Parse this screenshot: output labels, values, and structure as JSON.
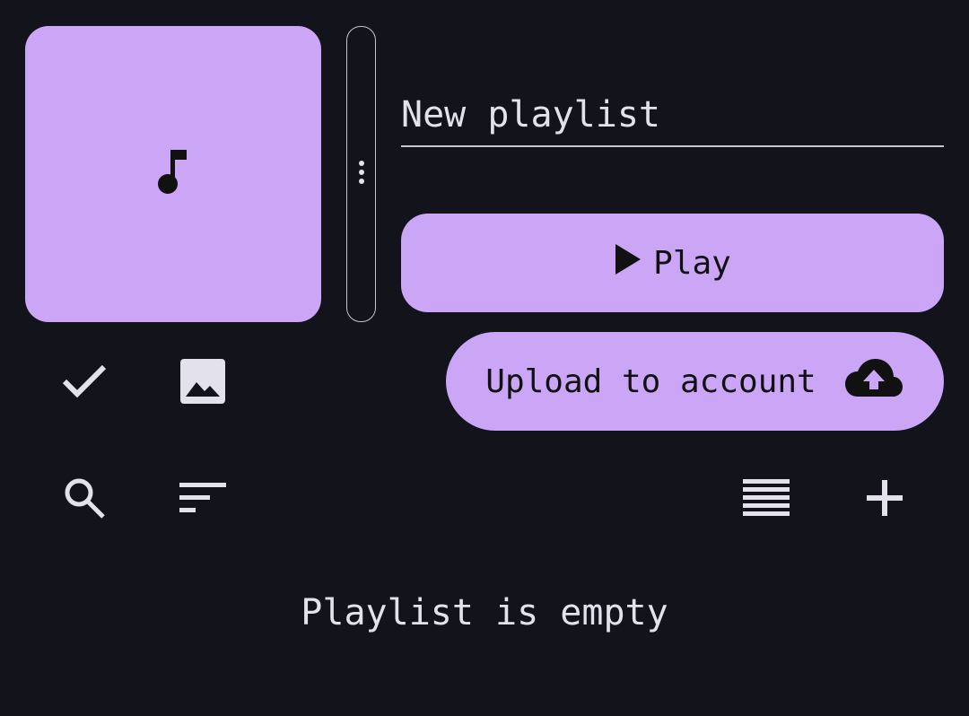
{
  "playlist": {
    "name_placeholder": "New playlist",
    "art_icon": "music-note-icon"
  },
  "actions": {
    "play_label": "Play",
    "upload_label": "Upload to account"
  },
  "toolbar": {
    "icons": [
      "check-icon",
      "image-icon",
      "search-icon",
      "sort-icon",
      "list-view-icon",
      "add-icon"
    ]
  },
  "main": {
    "empty_message": "Playlist is empty"
  },
  "colors": {
    "accent": "#cba6f7",
    "background": "#13131b",
    "foreground": "#e2e1ec"
  }
}
